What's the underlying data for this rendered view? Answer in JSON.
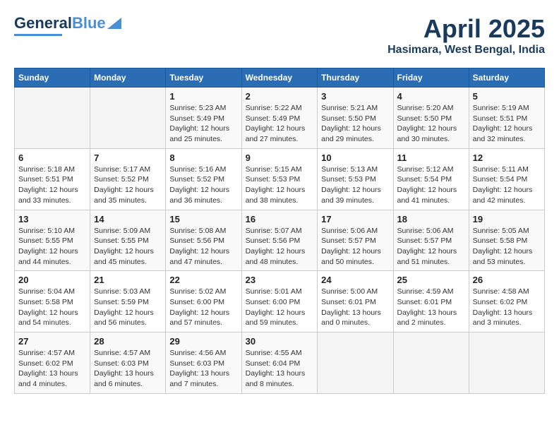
{
  "header": {
    "logo_general": "General",
    "logo_blue": "Blue",
    "month_title": "April 2025",
    "location": "Hasimara, West Bengal, India"
  },
  "calendar": {
    "weekdays": [
      "Sunday",
      "Monday",
      "Tuesday",
      "Wednesday",
      "Thursday",
      "Friday",
      "Saturday"
    ],
    "weeks": [
      [
        {
          "day": "",
          "sunrise": "",
          "sunset": "",
          "daylight": ""
        },
        {
          "day": "",
          "sunrise": "",
          "sunset": "",
          "daylight": ""
        },
        {
          "day": "1",
          "sunrise": "Sunrise: 5:23 AM",
          "sunset": "Sunset: 5:49 PM",
          "daylight": "Daylight: 12 hours and 25 minutes."
        },
        {
          "day": "2",
          "sunrise": "Sunrise: 5:22 AM",
          "sunset": "Sunset: 5:49 PM",
          "daylight": "Daylight: 12 hours and 27 minutes."
        },
        {
          "day": "3",
          "sunrise": "Sunrise: 5:21 AM",
          "sunset": "Sunset: 5:50 PM",
          "daylight": "Daylight: 12 hours and 29 minutes."
        },
        {
          "day": "4",
          "sunrise": "Sunrise: 5:20 AM",
          "sunset": "Sunset: 5:50 PM",
          "daylight": "Daylight: 12 hours and 30 minutes."
        },
        {
          "day": "5",
          "sunrise": "Sunrise: 5:19 AM",
          "sunset": "Sunset: 5:51 PM",
          "daylight": "Daylight: 12 hours and 32 minutes."
        }
      ],
      [
        {
          "day": "6",
          "sunrise": "Sunrise: 5:18 AM",
          "sunset": "Sunset: 5:51 PM",
          "daylight": "Daylight: 12 hours and 33 minutes."
        },
        {
          "day": "7",
          "sunrise": "Sunrise: 5:17 AM",
          "sunset": "Sunset: 5:52 PM",
          "daylight": "Daylight: 12 hours and 35 minutes."
        },
        {
          "day": "8",
          "sunrise": "Sunrise: 5:16 AM",
          "sunset": "Sunset: 5:52 PM",
          "daylight": "Daylight: 12 hours and 36 minutes."
        },
        {
          "day": "9",
          "sunrise": "Sunrise: 5:15 AM",
          "sunset": "Sunset: 5:53 PM",
          "daylight": "Daylight: 12 hours and 38 minutes."
        },
        {
          "day": "10",
          "sunrise": "Sunrise: 5:13 AM",
          "sunset": "Sunset: 5:53 PM",
          "daylight": "Daylight: 12 hours and 39 minutes."
        },
        {
          "day": "11",
          "sunrise": "Sunrise: 5:12 AM",
          "sunset": "Sunset: 5:54 PM",
          "daylight": "Daylight: 12 hours and 41 minutes."
        },
        {
          "day": "12",
          "sunrise": "Sunrise: 5:11 AM",
          "sunset": "Sunset: 5:54 PM",
          "daylight": "Daylight: 12 hours and 42 minutes."
        }
      ],
      [
        {
          "day": "13",
          "sunrise": "Sunrise: 5:10 AM",
          "sunset": "Sunset: 5:55 PM",
          "daylight": "Daylight: 12 hours and 44 minutes."
        },
        {
          "day": "14",
          "sunrise": "Sunrise: 5:09 AM",
          "sunset": "Sunset: 5:55 PM",
          "daylight": "Daylight: 12 hours and 45 minutes."
        },
        {
          "day": "15",
          "sunrise": "Sunrise: 5:08 AM",
          "sunset": "Sunset: 5:56 PM",
          "daylight": "Daylight: 12 hours and 47 minutes."
        },
        {
          "day": "16",
          "sunrise": "Sunrise: 5:07 AM",
          "sunset": "Sunset: 5:56 PM",
          "daylight": "Daylight: 12 hours and 48 minutes."
        },
        {
          "day": "17",
          "sunrise": "Sunrise: 5:06 AM",
          "sunset": "Sunset: 5:57 PM",
          "daylight": "Daylight: 12 hours and 50 minutes."
        },
        {
          "day": "18",
          "sunrise": "Sunrise: 5:06 AM",
          "sunset": "Sunset: 5:57 PM",
          "daylight": "Daylight: 12 hours and 51 minutes."
        },
        {
          "day": "19",
          "sunrise": "Sunrise: 5:05 AM",
          "sunset": "Sunset: 5:58 PM",
          "daylight": "Daylight: 12 hours and 53 minutes."
        }
      ],
      [
        {
          "day": "20",
          "sunrise": "Sunrise: 5:04 AM",
          "sunset": "Sunset: 5:58 PM",
          "daylight": "Daylight: 12 hours and 54 minutes."
        },
        {
          "day": "21",
          "sunrise": "Sunrise: 5:03 AM",
          "sunset": "Sunset: 5:59 PM",
          "daylight": "Daylight: 12 hours and 56 minutes."
        },
        {
          "day": "22",
          "sunrise": "Sunrise: 5:02 AM",
          "sunset": "Sunset: 6:00 PM",
          "daylight": "Daylight: 12 hours and 57 minutes."
        },
        {
          "day": "23",
          "sunrise": "Sunrise: 5:01 AM",
          "sunset": "Sunset: 6:00 PM",
          "daylight": "Daylight: 12 hours and 59 minutes."
        },
        {
          "day": "24",
          "sunrise": "Sunrise: 5:00 AM",
          "sunset": "Sunset: 6:01 PM",
          "daylight": "Daylight: 13 hours and 0 minutes."
        },
        {
          "day": "25",
          "sunrise": "Sunrise: 4:59 AM",
          "sunset": "Sunset: 6:01 PM",
          "daylight": "Daylight: 13 hours and 2 minutes."
        },
        {
          "day": "26",
          "sunrise": "Sunrise: 4:58 AM",
          "sunset": "Sunset: 6:02 PM",
          "daylight": "Daylight: 13 hours and 3 minutes."
        }
      ],
      [
        {
          "day": "27",
          "sunrise": "Sunrise: 4:57 AM",
          "sunset": "Sunset: 6:02 PM",
          "daylight": "Daylight: 13 hours and 4 minutes."
        },
        {
          "day": "28",
          "sunrise": "Sunrise: 4:57 AM",
          "sunset": "Sunset: 6:03 PM",
          "daylight": "Daylight: 13 hours and 6 minutes."
        },
        {
          "day": "29",
          "sunrise": "Sunrise: 4:56 AM",
          "sunset": "Sunset: 6:03 PM",
          "daylight": "Daylight: 13 hours and 7 minutes."
        },
        {
          "day": "30",
          "sunrise": "Sunrise: 4:55 AM",
          "sunset": "Sunset: 6:04 PM",
          "daylight": "Daylight: 13 hours and 8 minutes."
        },
        {
          "day": "",
          "sunrise": "",
          "sunset": "",
          "daylight": ""
        },
        {
          "day": "",
          "sunrise": "",
          "sunset": "",
          "daylight": ""
        },
        {
          "day": "",
          "sunrise": "",
          "sunset": "",
          "daylight": ""
        }
      ]
    ]
  }
}
